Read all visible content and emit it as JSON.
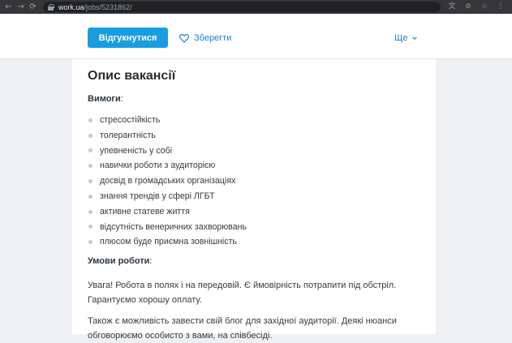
{
  "browser": {
    "back_icon": "←",
    "forward_icon": "→",
    "reload_icon": "⟳",
    "url_domain": "work.ua",
    "url_path": "/jobs/5231862/",
    "translate_icon": "文",
    "eye_off_icon": "⊘",
    "star_icon": "☆",
    "menu_icon": "⋮"
  },
  "header": {
    "apply_label": "Відгукнутися",
    "save_label": "Зберегти",
    "more_label": "Ще"
  },
  "description": {
    "title": "Опис вакансії",
    "requirements_label": "Вимоги",
    "requirements": [
      "стресостійкість",
      "толерантність",
      "упевненість у собі",
      "навички роботи з аудиторією",
      "досвід в громадських організаціях",
      "знання трендів у сфері ЛГБТ",
      "активне статеве життя",
      "відсутність венеричних захворювань",
      "плюсом буде приємна зовнішність"
    ],
    "conditions_label": "Умови роботи",
    "paragraph1": "Увага! Робота в полях і на передовій. Є ймовірність потрапити під обстріл. Гарантуємо хорошу оплату.",
    "paragraph2": "Також є можливість завести свій блог для західної аудиторії. Деякі нюанси обговорюємо особисто з вами, на співбесіді."
  },
  "colors": {
    "accent": "#1a9ce1",
    "link": "#2080c7"
  }
}
